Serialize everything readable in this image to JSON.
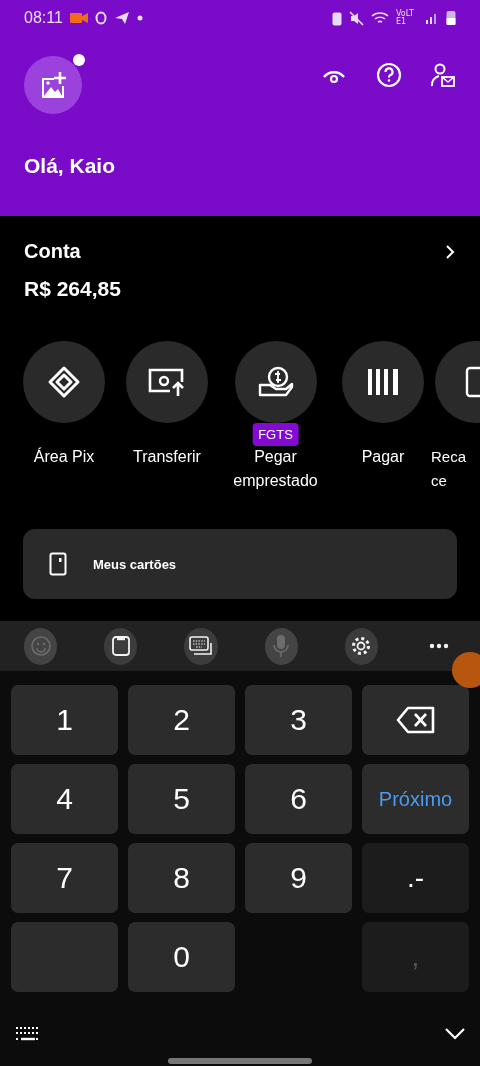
{
  "status_bar": {
    "time": "08:11",
    "network": "VoLTE1"
  },
  "header": {
    "greeting": "Olá, Kaio",
    "avatar_notification": true
  },
  "account": {
    "title": "Conta",
    "balance": "R$ 264,85"
  },
  "actions": [
    {
      "kind": "pix",
      "lines": [
        "Área Pix"
      ]
    },
    {
      "kind": "transfer",
      "lines": [
        "Transferir"
      ]
    },
    {
      "kind": "loan",
      "lines": [
        "Pegar",
        "emprestado"
      ],
      "badge": "FGTS"
    },
    {
      "kind": "pay",
      "lines": [
        "Pagar"
      ]
    },
    {
      "kind": "recharge",
      "lines": [
        "Reca",
        "ce"
      ]
    }
  ],
  "cards_button": {
    "label": "Meus cartões"
  },
  "keyboard": {
    "toolbar": [
      {
        "kind": "emoji",
        "disabled": true
      },
      {
        "kind": "clipboard",
        "disabled": false
      },
      {
        "kind": "keyboard",
        "disabled": false
      },
      {
        "kind": "mic",
        "disabled": true
      },
      {
        "kind": "settings",
        "disabled": false
      },
      {
        "kind": "more",
        "disabled": false
      }
    ],
    "keys": [
      {
        "kind": "digit",
        "label": "1"
      },
      {
        "kind": "digit",
        "label": "2"
      },
      {
        "kind": "digit",
        "label": "3"
      },
      {
        "kind": "backspace"
      },
      {
        "kind": "digit",
        "label": "4"
      },
      {
        "kind": "digit",
        "label": "5"
      },
      {
        "kind": "digit",
        "label": "6"
      },
      {
        "kind": "action",
        "label": "Próximo"
      },
      {
        "kind": "digit",
        "label": "7"
      },
      {
        "kind": "digit",
        "label": "8"
      },
      {
        "kind": "digit",
        "label": "9"
      },
      {
        "kind": "symbol",
        "label": ".-"
      },
      {
        "kind": "blank"
      },
      {
        "kind": "digit",
        "label": "0"
      },
      {
        "kind": "empty"
      },
      {
        "kind": "symbol",
        "label": ",",
        "disabled": true
      }
    ]
  }
}
